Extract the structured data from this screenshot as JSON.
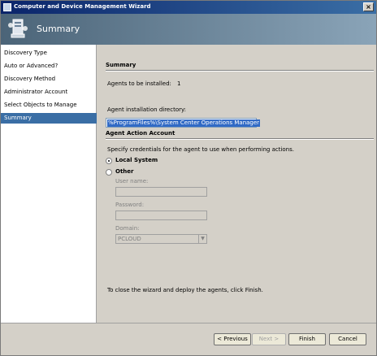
{
  "window": {
    "title": "Computer and Device Management Wizard",
    "close_glyph": "×"
  },
  "header": {
    "title": "Summary",
    "icon": "wizard-computer-icon"
  },
  "nav": {
    "items": [
      {
        "label": "Discovery Type"
      },
      {
        "label": "Auto or Advanced?"
      },
      {
        "label": "Discovery Method"
      },
      {
        "label": "Administrator Account"
      },
      {
        "label": "Select Objects to Manage"
      },
      {
        "label": "Summary",
        "selected": true
      }
    ]
  },
  "summary": {
    "section_title": "Summary",
    "agents_label": "Agents to be installed:",
    "agents_count": "1",
    "dir_label": "Agent installation directory:",
    "dir_value": "%ProgramFiles%\\System Center Operations Manager"
  },
  "action_account": {
    "section_title": "Agent Action Account",
    "description": "Specify credentials for the agent to use when performing actions.",
    "local_system_label": "Local System",
    "other_label": "Other",
    "selected": "Local System",
    "username_label": "User name:",
    "username_value": "",
    "password_label": "Password:",
    "password_value": "",
    "domain_label": "Domain:",
    "domain_value": "PCLOUD"
  },
  "footer_note": "To close the wizard and deploy the agents, click Finish.",
  "buttons": {
    "previous": "< Previous",
    "next": "Next >",
    "finish": "Finish",
    "cancel": "Cancel"
  },
  "colors": {
    "title_bar": "#0a246a",
    "header_band": "#4b6478",
    "nav_selected": "#3a6ea5",
    "text_selection": "#316ac5"
  }
}
